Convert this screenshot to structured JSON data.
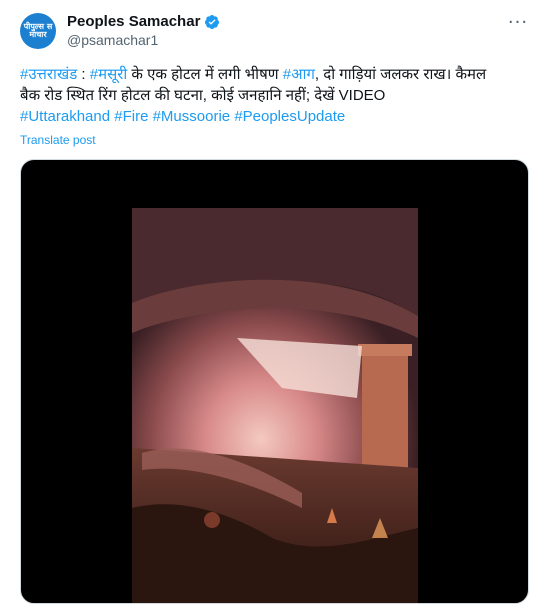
{
  "account": {
    "display_name": "Peoples Samachar",
    "handle": "@psamachar1",
    "avatar_text": "पीपुल्स समाचार"
  },
  "tweet": {
    "line1_tag1": "#उत्तराखंड",
    "line1_sep": " : ",
    "line1_tag2": "#मसूरी",
    "line1_text1": " के एक होटल में लगी भीषण ",
    "line1_tag3": "#आग",
    "line1_text2": ", दो गाड़ियां जलकर राख। कैमल",
    "line2_text": "बैक रोड स्थित रिंग होटल की घटना, कोई जनहानि नहीं; देखें VIDEO",
    "hashtags": [
      "#Uttarakhand",
      "#Fire",
      "#Mussoorie",
      "#PeoplesUpdate"
    ]
  },
  "translate_label": "Translate post",
  "more_label": "···",
  "colors": {
    "link": "#1d9bf0",
    "verified": "#1d9bf0",
    "text": "#0f1419",
    "muted": "#536471"
  }
}
